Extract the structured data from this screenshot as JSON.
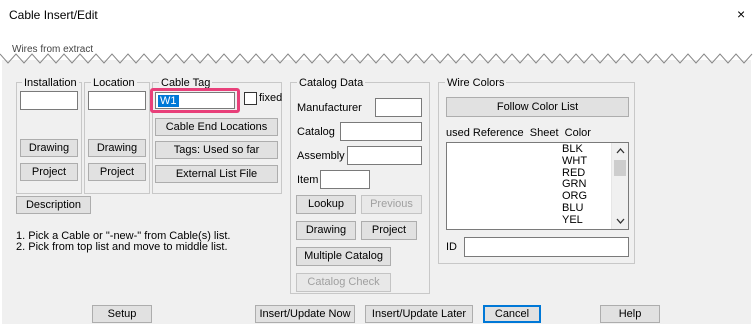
{
  "window": {
    "title": "Cable Insert/Edit",
    "close_glyph": "×"
  },
  "banner": {
    "text": "Wires from extract"
  },
  "left": {
    "installation_label": "Installation",
    "location_label": "Location",
    "cable_tag_label": "Cable Tag",
    "cable_tag_value": "W1",
    "fixed_label": "fixed",
    "drawing_label": "Drawing",
    "project_label": "Project",
    "cable_end_locations_label": "Cable End Locations",
    "tags_used_label": "Tags: Used so far",
    "external_list_label": "External List File",
    "description_label": "Description",
    "instructions": [
      "1. Pick a Cable or \"-new-\" from Cable(s) list.",
      "2. Pick from top list and move to middle list."
    ]
  },
  "catalog": {
    "group_label": "Catalog Data",
    "manufacturer_label": "Manufacturer",
    "catalog_label": "Catalog",
    "assembly_label": "Assembly",
    "item_label": "Item",
    "lookup_label": "Lookup",
    "previous_label": "Previous",
    "drawing_label": "Drawing",
    "project_label": "Project",
    "multiple_catalog_label": "Multiple Catalog",
    "catalog_check_label": "Catalog Check"
  },
  "wire_colors": {
    "group_label": "Wire Colors",
    "follow_color_list_label": "Follow Color List",
    "columns_header": "used Reference  Sheet  Color",
    "colors": [
      "BLK",
      "WHT",
      "RED",
      "GRN",
      "ORG",
      "BLU",
      "YEL"
    ],
    "id_label": "ID"
  },
  "footer": {
    "setup_label": "Setup",
    "insert_now_label": "Insert/Update Now",
    "insert_later_label": "Insert/Update Later",
    "cancel_label": "Cancel",
    "help_label": "Help"
  },
  "colors": {
    "highlight": "#e8407a",
    "selection": "#0078d7",
    "dialog_bg": "#f0f0f0"
  }
}
